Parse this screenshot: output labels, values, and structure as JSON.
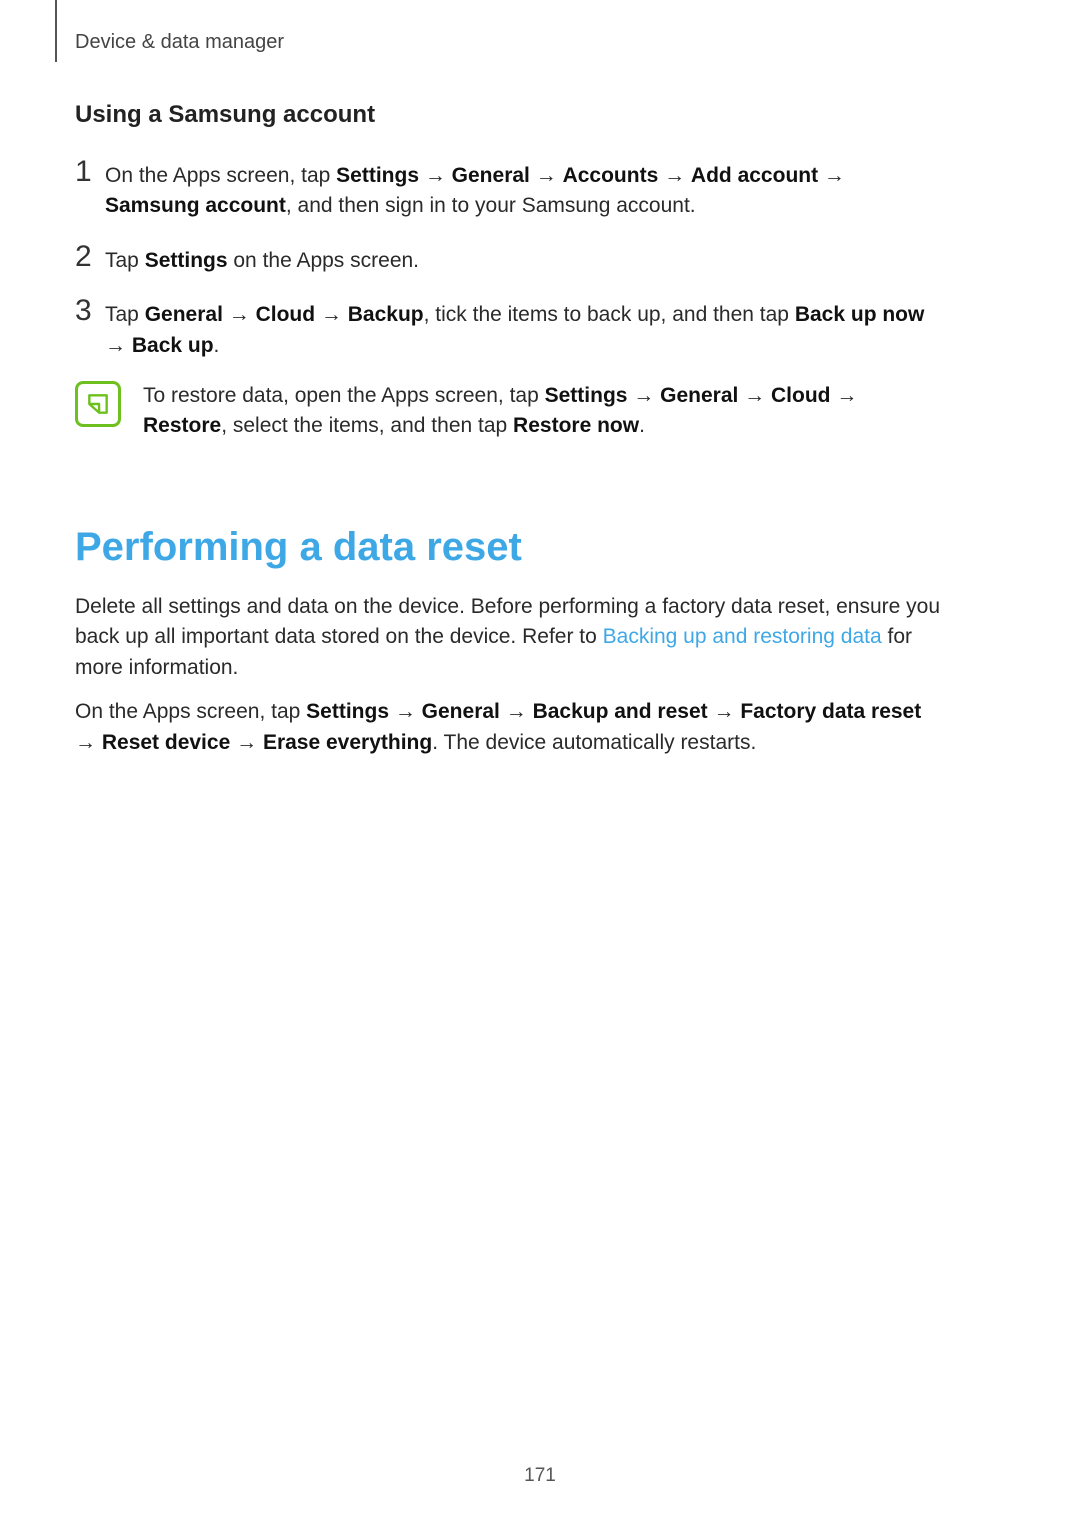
{
  "header": {
    "breadcrumb": "Device & data manager"
  },
  "section1": {
    "heading": "Using a Samsung account",
    "steps": [
      {
        "n": "1",
        "runs": [
          {
            "t": "On the Apps screen, tap "
          },
          {
            "t": "Settings",
            "b": true
          },
          {
            "t": " → "
          },
          {
            "t": "General",
            "b": true
          },
          {
            "t": " → "
          },
          {
            "t": "Accounts",
            "b": true
          },
          {
            "t": " → "
          },
          {
            "t": "Add account",
            "b": true
          },
          {
            "t": " → "
          },
          {
            "t": "Samsung account",
            "b": true
          },
          {
            "t": ", and then sign in to your Samsung account."
          }
        ]
      },
      {
        "n": "2",
        "runs": [
          {
            "t": "Tap "
          },
          {
            "t": "Settings",
            "b": true
          },
          {
            "t": " on the Apps screen."
          }
        ]
      },
      {
        "n": "3",
        "runs": [
          {
            "t": "Tap "
          },
          {
            "t": "General",
            "b": true
          },
          {
            "t": " → "
          },
          {
            "t": "Cloud",
            "b": true
          },
          {
            "t": " → "
          },
          {
            "t": "Backup",
            "b": true
          },
          {
            "t": ", tick the items to back up, and then tap "
          },
          {
            "t": "Back up now",
            "b": true
          },
          {
            "t": " → "
          },
          {
            "t": "Back up",
            "b": true
          },
          {
            "t": "."
          }
        ]
      }
    ],
    "note": {
      "runs": [
        {
          "t": "To restore data, open the Apps screen, tap "
        },
        {
          "t": "Settings",
          "b": true
        },
        {
          "t": " → "
        },
        {
          "t": "General",
          "b": true
        },
        {
          "t": " → "
        },
        {
          "t": "Cloud",
          "b": true
        },
        {
          "t": " → "
        },
        {
          "t": "Restore",
          "b": true
        },
        {
          "t": ", select the items, and then tap "
        },
        {
          "t": "Restore now",
          "b": true
        },
        {
          "t": "."
        }
      ]
    }
  },
  "section2": {
    "title": "Performing a data reset",
    "para1": {
      "runs": [
        {
          "t": "Delete all settings and data on the device. Before performing a factory data reset, ensure you back up all important data stored on the device. Refer to "
        },
        {
          "t": "Backing up and restoring data",
          "link": true
        },
        {
          "t": " for more information."
        }
      ]
    },
    "para2": {
      "runs": [
        {
          "t": "On the Apps screen, tap "
        },
        {
          "t": "Settings",
          "b": true
        },
        {
          "t": " → "
        },
        {
          "t": "General",
          "b": true
        },
        {
          "t": " → "
        },
        {
          "t": "Backup and reset",
          "b": true
        },
        {
          "t": " → "
        },
        {
          "t": "Factory data reset",
          "b": true
        },
        {
          "t": " → "
        },
        {
          "t": "Reset device",
          "b": true
        },
        {
          "t": " → "
        },
        {
          "t": "Erase everything",
          "b": true
        },
        {
          "t": ". The device automatically restarts."
        }
      ]
    }
  },
  "page": "171"
}
